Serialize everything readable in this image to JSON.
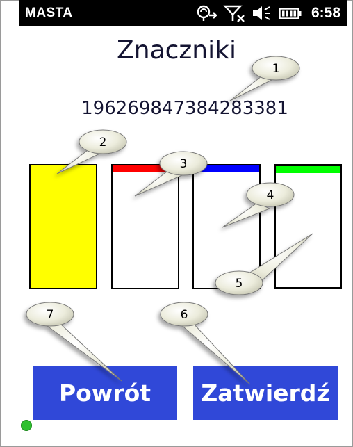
{
  "status_bar": {
    "carrier": "MASTA",
    "time": "6:58",
    "icons": [
      "sync-icon",
      "signal-off-icon",
      "volume-icon",
      "battery-icon"
    ]
  },
  "page": {
    "title": "Znaczniki",
    "code": "196269847384283381"
  },
  "slots": [
    {
      "name": "slot-1",
      "fill": "#ffff00",
      "accent": null,
      "selected": false
    },
    {
      "name": "slot-2",
      "fill": "#ffffff",
      "accent": "#ff0000",
      "selected": false
    },
    {
      "name": "slot-3",
      "fill": "#ffffff",
      "accent": "#0000ff",
      "selected": false
    },
    {
      "name": "slot-4",
      "fill": "#ffffff",
      "accent": "#00ff00",
      "selected": true
    }
  ],
  "buttons": {
    "back_label": "Powrót",
    "confirm_label": "Zatwierdź"
  },
  "callouts": [
    "1",
    "2",
    "3",
    "4",
    "5",
    "6",
    "7"
  ],
  "colors": {
    "button": "#3048d8",
    "text": "#141432",
    "indicator": "#2ec02e"
  }
}
